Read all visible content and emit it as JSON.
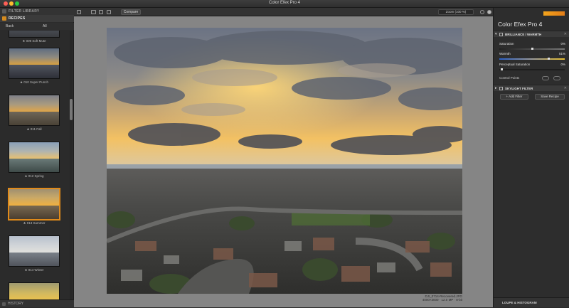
{
  "window": {
    "title": "Color Efex Pro 4"
  },
  "left_panel": {
    "filter_library": "FILTER LIBRARY",
    "recipes": "RECIPES",
    "back": "Back",
    "all": "All",
    "thumbnails": [
      {
        "label": "★ 009 Soft Mute",
        "selected": false
      },
      {
        "label": "★ 010 Super Punch",
        "selected": false
      },
      {
        "label": "★ 011 Fall",
        "selected": false
      },
      {
        "label": "★ 012 Spring",
        "selected": false
      },
      {
        "label": "★ 013 Summer",
        "selected": true
      },
      {
        "label": "★ 014 Winter",
        "selected": false
      }
    ],
    "history": "HISTORY"
  },
  "toolbar": {
    "compare": "Compare",
    "zoom": "Zoom (100 %)"
  },
  "image": {
    "filename": "DJI_0714-Recovered.JPG",
    "meta": "4000×3000 · 12.0 MP · 8-bit"
  },
  "right_panel": {
    "brand": "Color Efex Pro",
    "brand_version": "4",
    "brilliance": {
      "title": "BRILLIANCE / WARMTH",
      "saturation_label": "Saturation",
      "saturation_value": "0%",
      "saturation_level": 0.5,
      "warmth_label": "Warmth",
      "warmth_value": "51%",
      "warmth_level": 0.76,
      "perceptual_label": "Perceptual Saturation",
      "perceptual_value": "0%",
      "perceptual_level": 0.02,
      "control_points": "Control Points"
    },
    "skylight": {
      "title": "SKYLIGHT FILTER"
    },
    "add_filter": "+ Add Filter",
    "save_recipe": "Save Recipe",
    "loupe": "LOUPE & HISTOGRAM"
  },
  "colors": {
    "accent": "#e08a1a",
    "canvas": "#858585"
  }
}
